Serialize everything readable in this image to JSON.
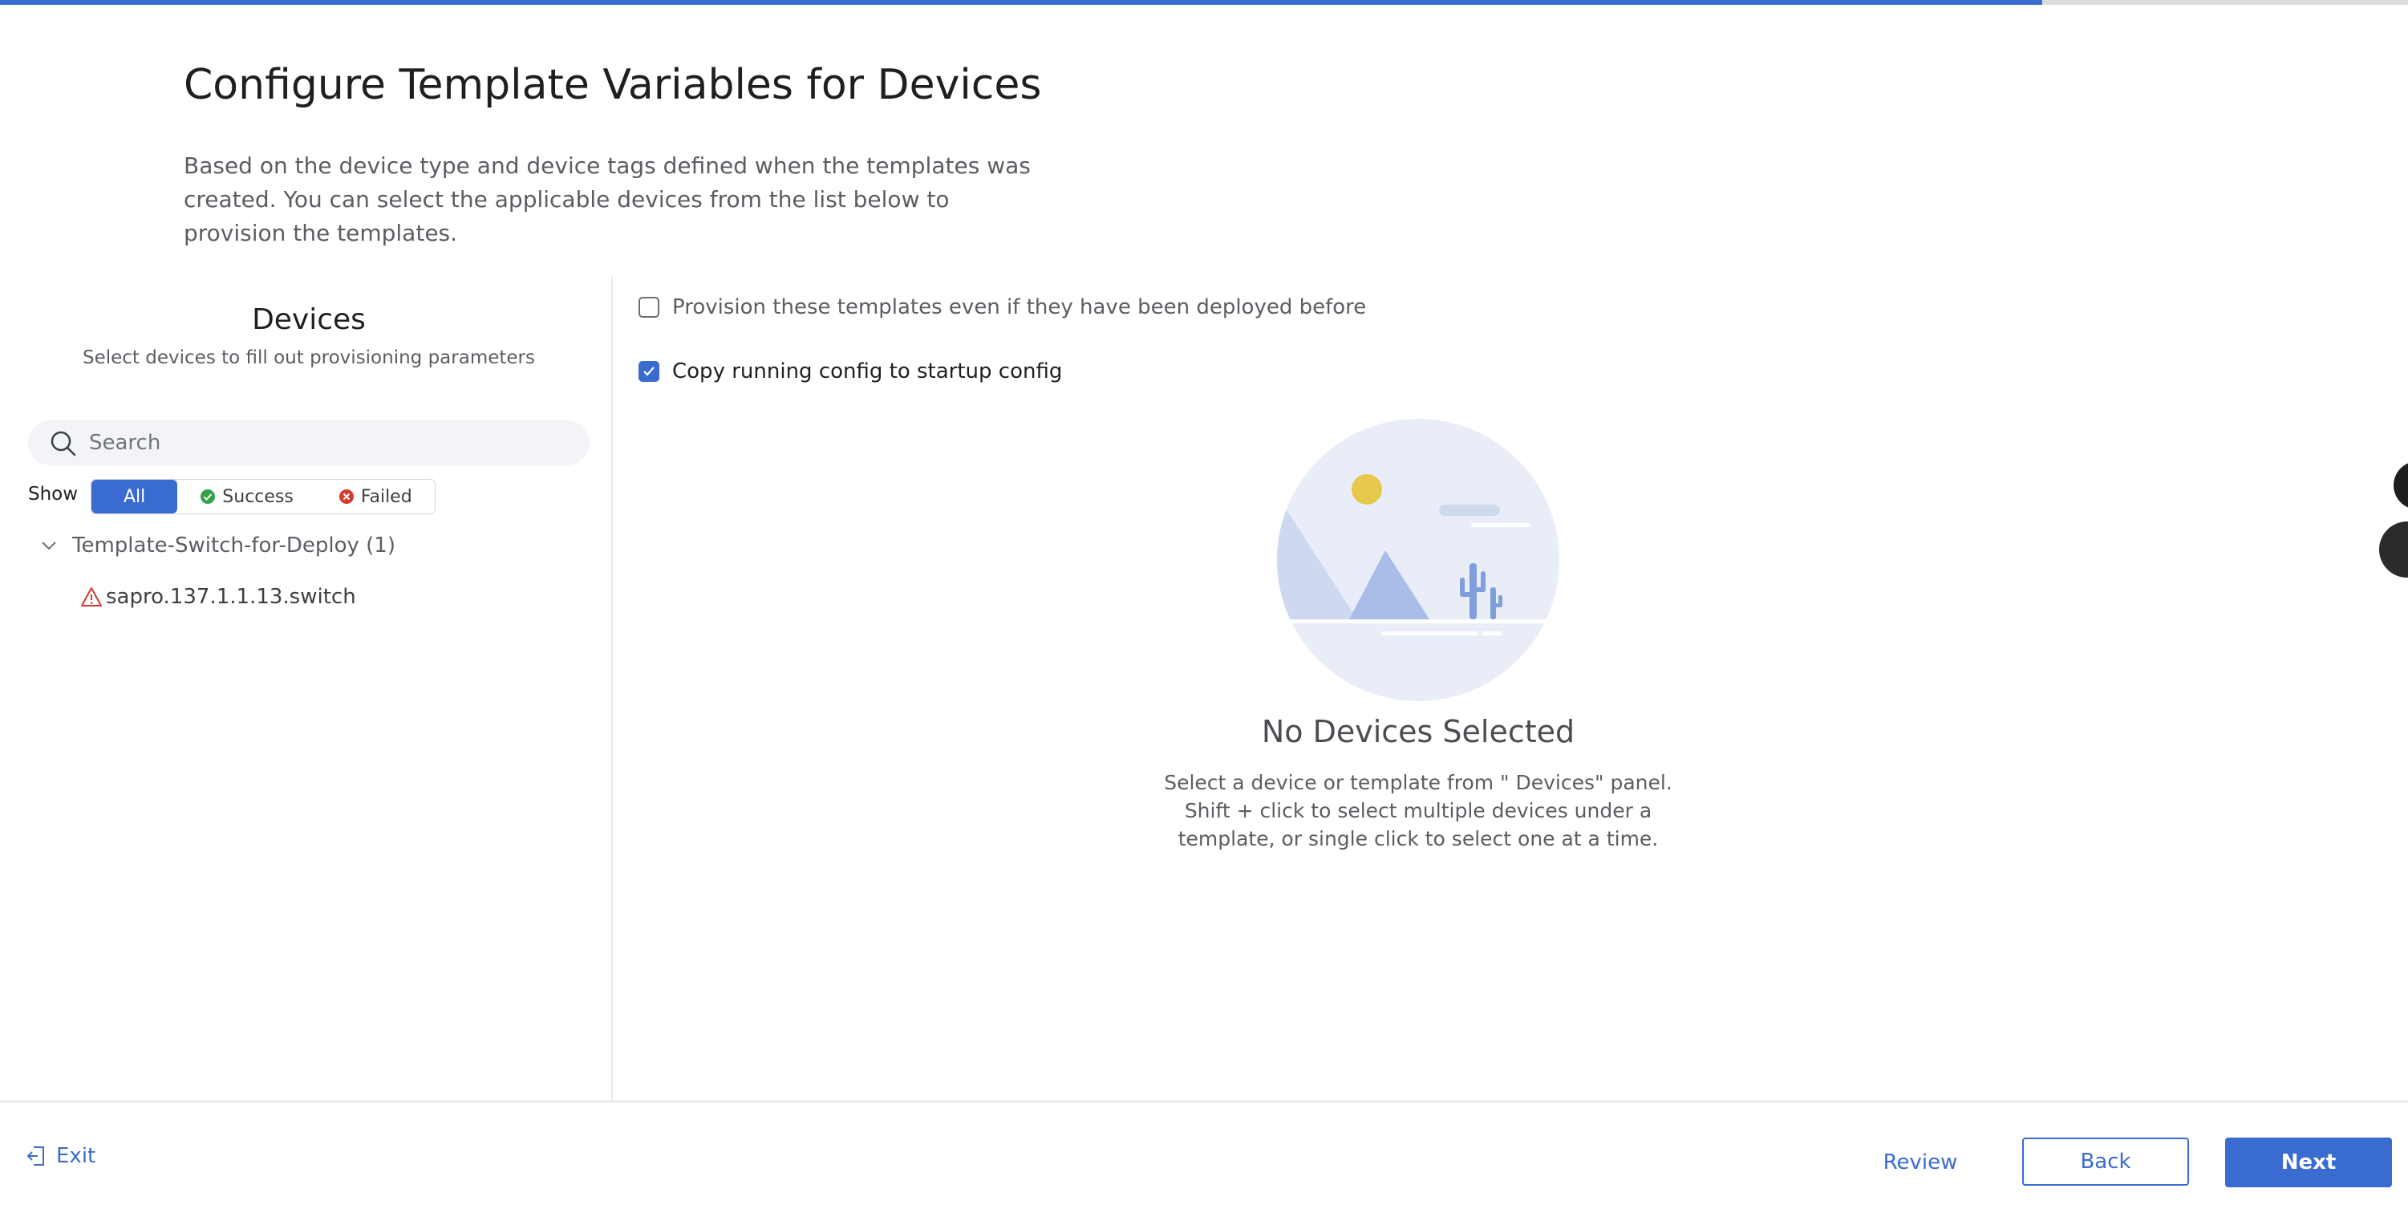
{
  "progress": {
    "fraction": 0.848,
    "fill_color": "#3a6bd1"
  },
  "page": {
    "title": "Configure Template Variables for Devices",
    "description": "Based on the device type and device tags defined when the templates was created. You can select the applicable devices from the list below to provision the templates."
  },
  "devices_panel": {
    "title": "Devices",
    "subtitle": "Select devices to fill out provisioning parameters",
    "search": {
      "placeholder": "Search",
      "value": ""
    },
    "filter": {
      "label": "Show",
      "options": [
        {
          "label": "All",
          "active": true
        },
        {
          "label": "Success",
          "icon": "success-icon"
        },
        {
          "label": "Failed",
          "icon": "failed-icon"
        }
      ]
    },
    "tree": {
      "group_label": "Template-Switch-for-Deploy (1)",
      "expanded": true,
      "items": [
        {
          "label": "sapro.137.1.1.13.switch",
          "status_icon": "warning-icon"
        }
      ]
    }
  },
  "options": {
    "provision_again": {
      "label": "Provision these templates even if they have been deployed before",
      "checked": false
    },
    "copy_config": {
      "label": "Copy running config to startup config",
      "checked": true
    }
  },
  "empty_state": {
    "illustration": "desert-landscape-illustration",
    "title": "No Devices Selected",
    "lines": [
      "Select a device or template from \" Devices\"  panel.",
      "Shift + click to select multiple devices under a",
      "template, or single click to select one at a time."
    ]
  },
  "footer": {
    "exit_label": "Exit",
    "review_label": "Review",
    "back_label": "Back",
    "next_label": "Next"
  },
  "colors": {
    "accent": "#3a6bd1",
    "success": "#35a245",
    "error": "#d33b2c"
  }
}
